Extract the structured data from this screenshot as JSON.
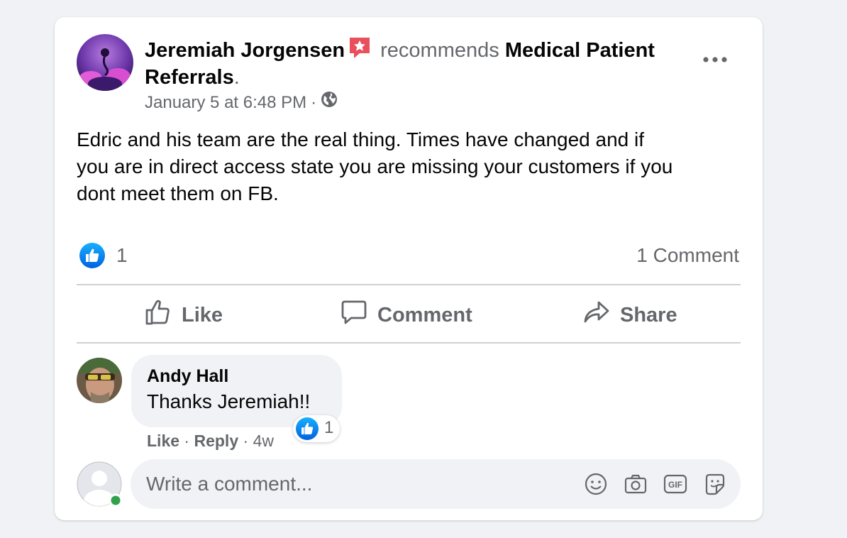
{
  "post": {
    "author": "Jeremiah Jorgensen",
    "verb": "recommends",
    "page_line1": "Medical Patient",
    "page_line2": "Referrals",
    "period": ".",
    "timestamp": "January 5 at 6:48 PM",
    "separator": "·",
    "privacy_icon": "globe-icon",
    "body_line1": "Edric and his team are the real thing.  Times have changed and if",
    "body_line2": "you are in direct access state you are missing your customers if you",
    "body_line3": "dont meet them on FB."
  },
  "stats": {
    "reaction_count": "1",
    "comments_label": "1 Comment"
  },
  "actions": {
    "like": "Like",
    "comment": "Comment",
    "share": "Share"
  },
  "comment": {
    "author": "Andy Hall",
    "text": "Thanks Jeremiah!!",
    "reaction_count": "1",
    "like": "Like",
    "reply": "Reply",
    "sep": "·",
    "age": "4w"
  },
  "composer": {
    "placeholder": "Write a comment...",
    "icons": [
      "emoji-icon",
      "camera-icon",
      "gif-icon",
      "sticker-icon"
    ]
  },
  "colors": {
    "like_blue": "#1877f2",
    "recommend_red": "#e8505b",
    "online_green": "#31a24c",
    "secondary_text": "#65676b"
  }
}
